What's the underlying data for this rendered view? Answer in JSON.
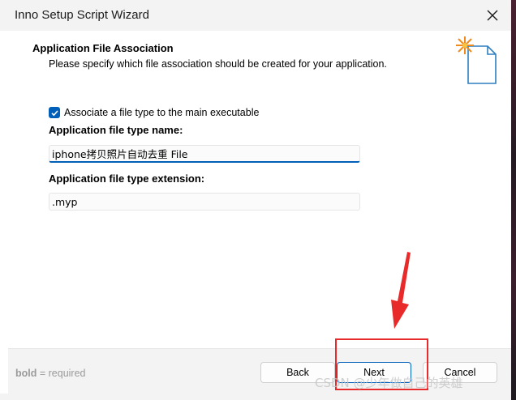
{
  "window": {
    "title": "Inno Setup Script Wizard"
  },
  "header": {
    "title": "Application File Association",
    "subtitle": "Please specify which file association should be created for your application."
  },
  "association": {
    "checkbox_label": "Associate a file type to the main executable",
    "checked": true
  },
  "fields": {
    "name_label": "Application file type name:",
    "name_value": "iphone拷贝照片自动去重 File",
    "extension_label": "Application file type extension:",
    "extension_value": ".myp"
  },
  "footer": {
    "hint_bold": "bold",
    "hint_rest": " = required",
    "back_label": "Back",
    "next_label": "Next",
    "cancel_label": "Cancel"
  },
  "watermark": "CSDN @少年做自己的英雄",
  "colors": {
    "accent": "#005fb8",
    "annotation": "#e82a2a"
  }
}
